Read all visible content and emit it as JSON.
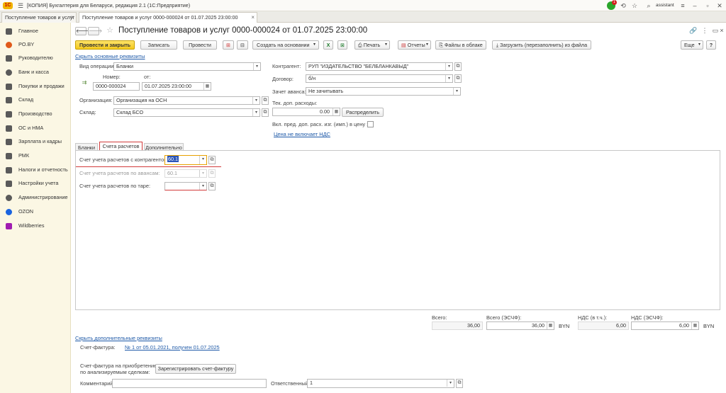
{
  "app": {
    "title": "[КОПИЯ] Бухгалтерия для Беларуси, редакция 2.1  (1С:Предприятие)",
    "logo": "1С",
    "notification_count": "1",
    "user": "assistant"
  },
  "tabs": [
    {
      "label": "Поступление товаров и услуг"
    },
    {
      "label": "Поступление товаров и услуг 0000-000024 от 01.07.2025 23:00:00"
    }
  ],
  "sidebar": {
    "items": [
      {
        "label": "Главное",
        "color": "#6b6b6b"
      },
      {
        "label": "PO.BY",
        "color": "#e05a1a"
      },
      {
        "label": "Руководителю",
        "color": "#6b6b6b"
      },
      {
        "label": "Банк и касса",
        "color": "#6b6b6b"
      },
      {
        "label": "Покупки и продажи",
        "color": "#6b6b6b"
      },
      {
        "label": "Склад",
        "color": "#6b6b6b"
      },
      {
        "label": "Производство",
        "color": "#6b6b6b"
      },
      {
        "label": "ОС и НМА",
        "color": "#6b6b6b"
      },
      {
        "label": "Зарплата и кадры",
        "color": "#6b6b6b"
      },
      {
        "label": "РМК",
        "color": "#6b6b6b"
      },
      {
        "label": "Налоги и отчетность",
        "color": "#6b6b6b"
      },
      {
        "label": "Настройки учета",
        "color": "#6b6b6b"
      },
      {
        "label": "Администрирование",
        "color": "#6b6b6b"
      },
      {
        "label": "OZON",
        "color": "#1a64e0"
      },
      {
        "label": "Wildberries",
        "color": "#a01cb0"
      }
    ]
  },
  "document": {
    "title": "Поступление товаров и услуг 0000-000024 от 01.07.2025 23:00:00"
  },
  "toolbar": {
    "post_close": "Провести и закрыть",
    "save": "Записать",
    "post": "Провести",
    "create_based": "Создать на основании",
    "print": "Печать",
    "reports": "Отчеты",
    "files_cloud": "Файлы в облаке",
    "load_file": "Загрузить (перезаполнить) из файла",
    "more": "Еще"
  },
  "header_section": {
    "hide_link": "Скрыть основные реквизиты",
    "operation_label": "Вид операции:",
    "operation_value": "Бланки",
    "number_label": "Номер:",
    "number_value": "0000-000024",
    "date_label": "от:",
    "date_value": "01.07.2025 23:00:00",
    "org_label": "Организация:",
    "org_value": "Организация на ОСН",
    "warehouse_label": "Склад:",
    "warehouse_value": "Склад БСО",
    "counterparty_label": "Контрагент:",
    "counterparty_value": "РУП \"ИЗДАТЕЛЬСТВО \"БЕЛБЛАНКАВЫД\"",
    "contract_label": "Договор:",
    "contract_value": "б/н",
    "advance_label": "Зачет аванса:",
    "advance_value": "Не зачитывать",
    "addcost_label": "Тек. доп. расходы:",
    "addcost_value": "0.00",
    "distribute_button": "Распределить",
    "include_label": "Вкл. пред. доп. расх. изг. (имп.) в цену :",
    "vat_link": "Цена не включает НДС"
  },
  "inner_tabs": [
    {
      "label": "Бланки"
    },
    {
      "label": "Счета расчетов"
    },
    {
      "label": "Дополнительно"
    }
  ],
  "accounts": {
    "counterparty_label": "Счет учета расчетов с контрагентом:",
    "counterparty_value": "60.1",
    "advances_label": "Счет учета расчетов по авансам:",
    "advances_value": "60.1",
    "tare_label": "Счет учета расчетов по таре:",
    "tare_value": ""
  },
  "totals": {
    "total_label": "Всего:",
    "total_value": "36,00",
    "total_esf_label": "Всего (ЭСЧФ):",
    "total_esf_value": "36,00",
    "currency": "BYN",
    "vat_label": "НДС (в т.ч.):",
    "vat_value": "6,00",
    "vat_esf_label": "НДС (ЭСЧФ):",
    "vat_esf_value": "6,00",
    "currency2": "BYN"
  },
  "footer": {
    "hide_link": "Скрыть дополнительные реквизиты",
    "invoice_label": "Счет-фактура:",
    "invoice_link": "№ 1 от 05.01.2021, получен 01.07.2025",
    "invoice_purchase_label1": "Счет-фактура на приобретение",
    "invoice_purchase_label2": "по анализируемым сделкам:",
    "register_button": "Зарегистрировать счет-фактуру",
    "comment_label": "Комментарий:",
    "comment_value": "",
    "responsible_label": "Ответственный:",
    "responsible_value": "1"
  }
}
